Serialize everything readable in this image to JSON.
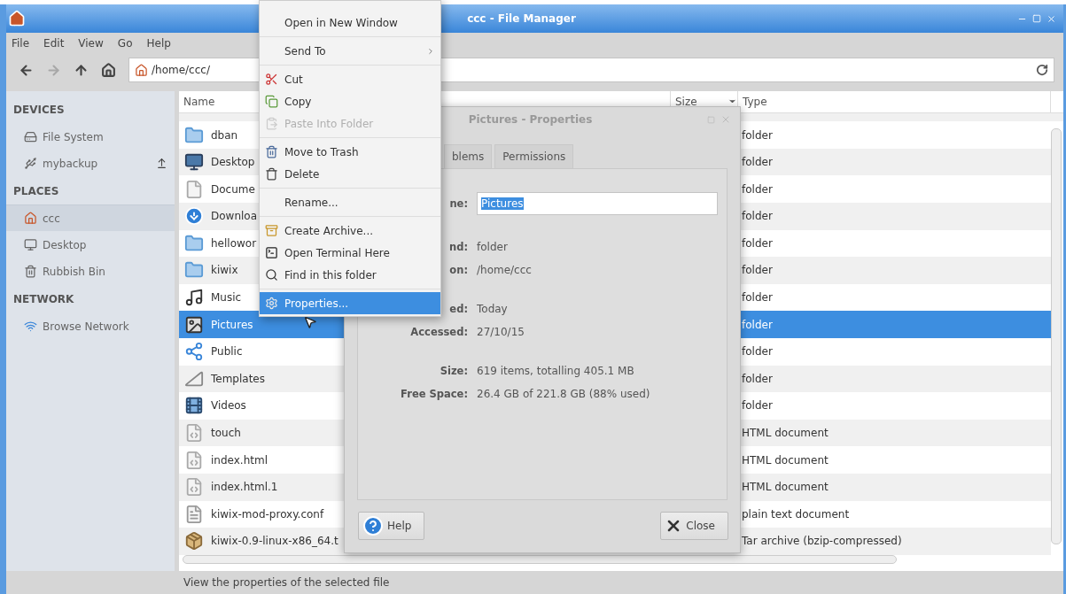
{
  "window": {
    "title": "ccc - File Manager"
  },
  "menu_bar": [
    "File",
    "Edit",
    "View",
    "Go",
    "Help"
  ],
  "nav_buttons": [
    {
      "kind": "back",
      "disabled": false
    },
    {
      "kind": "forward",
      "disabled": true
    },
    {
      "kind": "up",
      "disabled": false
    },
    {
      "kind": "home",
      "disabled": false
    }
  ],
  "location": {
    "value": "/home/ccc/"
  },
  "sidebar": [
    {
      "title": "DEVICES",
      "items": [
        {
          "label": "File System",
          "kind": "drive",
          "selected": false,
          "eject": false
        },
        {
          "label": "mybackup",
          "kind": "usb",
          "selected": false,
          "eject": true
        }
      ]
    },
    {
      "title": "PLACES",
      "items": [
        {
          "label": "ccc",
          "kind": "home",
          "selected": true,
          "eject": false
        },
        {
          "label": "Desktop",
          "kind": "desktop",
          "selected": false,
          "eject": false
        },
        {
          "label": "Rubbish Bin",
          "kind": "trash",
          "selected": false,
          "eject": false
        }
      ]
    },
    {
      "title": "NETWORK",
      "items": [
        {
          "label": "Browse Network",
          "kind": "network",
          "selected": false,
          "eject": false
        }
      ]
    }
  ],
  "table": {
    "columns": [
      "Name",
      "Size",
      "Type"
    ],
    "rows": [
      {
        "name": "dban",
        "type": "folder",
        "kind": "folder",
        "selected": false
      },
      {
        "name": "Desktop",
        "type": "folder",
        "kind": "desktop",
        "selected": false
      },
      {
        "name": "Docume",
        "type": "folder",
        "kind": "document",
        "selected": false
      },
      {
        "name": "Downloa",
        "type": "folder",
        "kind": "download",
        "selected": false
      },
      {
        "name": "hellowor",
        "type": "folder",
        "kind": "folder",
        "selected": false
      },
      {
        "name": "kiwix",
        "type": "folder",
        "kind": "folder",
        "selected": false
      },
      {
        "name": "Music",
        "type": "folder",
        "kind": "music",
        "selected": false
      },
      {
        "name": "Pictures",
        "type": "folder",
        "kind": "pictures",
        "selected": true
      },
      {
        "name": "Public",
        "type": "folder",
        "kind": "public",
        "selected": false
      },
      {
        "name": "Templates",
        "type": "folder",
        "kind": "templates",
        "selected": false
      },
      {
        "name": "Videos",
        "type": "folder",
        "kind": "videos",
        "selected": false
      },
      {
        "name": "touch",
        "type": "HTML document",
        "kind": "html",
        "selected": false
      },
      {
        "name": "index.html",
        "type": "HTML document",
        "kind": "html",
        "selected": false
      },
      {
        "name": "index.html.1",
        "type": "HTML document",
        "kind": "html",
        "selected": false
      },
      {
        "name": "kiwix-mod-proxy.conf",
        "type": "plain text document",
        "kind": "text",
        "selected": false
      },
      {
        "name": "kiwix-0.9-linux-x86_64.t",
        "type": "Tar archive (bzip-compressed)",
        "kind": "archive",
        "selected": false
      }
    ]
  },
  "status_bar": "View the properties of the selected file",
  "dialog": {
    "title": "Pictures - Properties",
    "tabs": [
      {
        "label": "blems",
        "selected": false
      },
      {
        "label": "Permissions",
        "selected": false
      }
    ],
    "name_label": "ne:",
    "name_value": "Pictures",
    "field_groups": [
      [
        {
          "label": "nd:",
          "value": "folder"
        },
        {
          "label": "on:",
          "value": "/home/ccc"
        }
      ],
      [
        {
          "label": "ed:",
          "value": "Today"
        },
        {
          "label": "Accessed:",
          "value": "27/10/15"
        }
      ],
      [
        {
          "label": "Size:",
          "value": "619 items, totalling 405.1 MB"
        },
        {
          "label": "Free Space:",
          "value": "26.4 GB of 221.8 GB (88% used)"
        }
      ]
    ],
    "buttons": [
      {
        "label": "Help",
        "kind": "help"
      },
      {
        "label": "Close",
        "kind": "close"
      }
    ]
  },
  "context_menu": [
    {
      "kind": "plain",
      "label": "Open in New Window",
      "disabled": false,
      "selected": false,
      "submenu": false
    },
    {
      "kind": "separator"
    },
    {
      "kind": "plain",
      "label": "Send To",
      "disabled": false,
      "selected": false,
      "submenu": true
    },
    {
      "kind": "separator"
    },
    {
      "kind": "cut",
      "label": "Cut",
      "disabled": false,
      "selected": false,
      "submenu": false
    },
    {
      "kind": "copy",
      "label": "Copy",
      "disabled": false,
      "selected": false,
      "submenu": false
    },
    {
      "kind": "paste",
      "label": "Paste Into Folder",
      "disabled": true,
      "selected": false,
      "submenu": false
    },
    {
      "kind": "separator"
    },
    {
      "kind": "trash",
      "label": "Move to Trash",
      "disabled": false,
      "selected": false,
      "submenu": false
    },
    {
      "kind": "delete",
      "label": "Delete",
      "disabled": false,
      "selected": false,
      "submenu": false
    },
    {
      "kind": "separator"
    },
    {
      "kind": "plain",
      "label": "Rename...",
      "disabled": false,
      "selected": false,
      "submenu": false
    },
    {
      "kind": "separator"
    },
    {
      "kind": "archive",
      "label": "Create Archive...",
      "disabled": false,
      "selected": false,
      "submenu": false
    },
    {
      "kind": "terminal",
      "label": "Open Terminal Here",
      "disabled": false,
      "selected": false,
      "submenu": false
    },
    {
      "kind": "find",
      "label": "Find in this folder",
      "disabled": false,
      "selected": false,
      "submenu": false
    },
    {
      "kind": "separator"
    },
    {
      "kind": "properties",
      "label": "Properties...",
      "disabled": false,
      "selected": true,
      "submenu": false
    }
  ]
}
